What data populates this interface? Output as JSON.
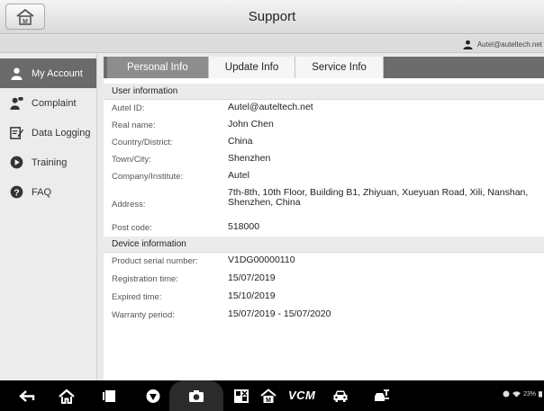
{
  "window": {
    "title": "Support"
  },
  "account": {
    "email": "Autel@auteltech.net"
  },
  "sidebar": {
    "items": [
      {
        "label": "My Account",
        "icon": "user-icon",
        "active": true
      },
      {
        "label": "Complaint",
        "icon": "complaint-icon",
        "active": false
      },
      {
        "label": "Data Logging",
        "icon": "data-logging-icon",
        "active": false
      },
      {
        "label": "Training",
        "icon": "play-icon",
        "active": false
      },
      {
        "label": "FAQ",
        "icon": "help-icon",
        "active": false
      }
    ]
  },
  "tabs": [
    {
      "label": "Personal Info",
      "active": true
    },
    {
      "label": "Update Info",
      "active": false
    },
    {
      "label": "Service Info",
      "active": false
    }
  ],
  "user_info": {
    "heading": "User information",
    "rows": [
      {
        "label": "Autel ID:",
        "value": "Autel@auteltech.net"
      },
      {
        "label": "Real name:",
        "value": "John Chen"
      },
      {
        "label": "Country/District:",
        "value": "China"
      },
      {
        "label": "Town/City:",
        "value": "Shenzhen"
      },
      {
        "label": "Company/Institute:",
        "value": "Autel"
      },
      {
        "label": "Address:",
        "value": "7th-8th, 10th Floor, Building B1, Zhiyuan, Xueyuan Road, Xili, Nanshan, Shenzhen, China"
      },
      {
        "label": "Post code:",
        "value": "518000"
      }
    ]
  },
  "device_info": {
    "heading": "Device information",
    "rows": [
      {
        "label": "Product serial number:",
        "value": "V1DG00000110"
      },
      {
        "label": "Registration time:",
        "value": "15/07/2019"
      },
      {
        "label": "Expired time:",
        "value": "15/10/2019"
      },
      {
        "label": "Warranty period:",
        "value": "15/07/2019 - 15/07/2020"
      }
    ]
  },
  "navbar": {
    "vcm_label": "VCM",
    "status_text": "23%",
    "icons": [
      "back-icon",
      "home-icon",
      "recent-apps-icon",
      "browser-icon",
      "camera-icon",
      "window-icon",
      "autel-home-icon",
      "vcm-icon",
      "car-icon",
      "car-repair-icon"
    ]
  },
  "colors": {
    "active_sidebar": "#6a6a6a",
    "tab_bar": "#6c6c6c",
    "active_tab": "#8d8d8d"
  }
}
